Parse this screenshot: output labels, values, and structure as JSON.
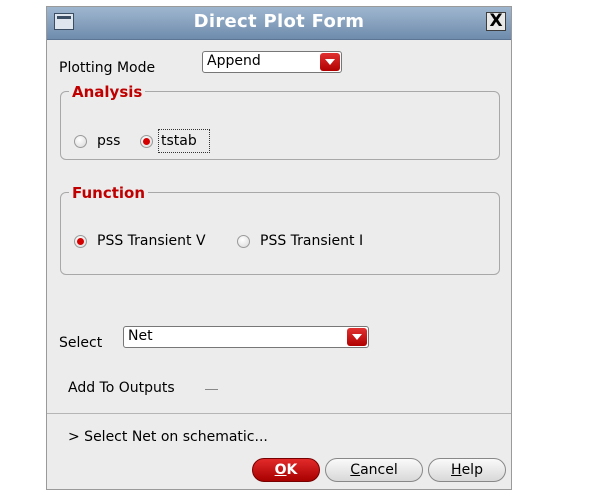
{
  "window": {
    "title": "Direct Plot Form",
    "close_symbol": "X"
  },
  "plotting_mode": {
    "label": "Plotting Mode",
    "value": "Append"
  },
  "analysis": {
    "legend": "Analysis",
    "options": [
      {
        "label": "pss",
        "checked": false
      },
      {
        "label": "tstab",
        "checked": true
      }
    ]
  },
  "function": {
    "legend": "Function",
    "options": [
      {
        "label": "PSS Transient V",
        "checked": true
      },
      {
        "label": "PSS Transient I",
        "checked": false
      }
    ]
  },
  "select": {
    "label": "Select",
    "value": "Net"
  },
  "add_to_outputs": {
    "label": "Add To Outputs",
    "checked": false
  },
  "status": "> Select Net on schematic...",
  "buttons": {
    "ok": {
      "mnemonic": "O",
      "rest": "K"
    },
    "cancel": {
      "mnemonic": "C",
      "rest": "ancel"
    },
    "help": {
      "mnemonic": "H",
      "rest": "elp"
    }
  },
  "colors": {
    "accent": "#c00000",
    "titlebar": "#7f9abb"
  }
}
